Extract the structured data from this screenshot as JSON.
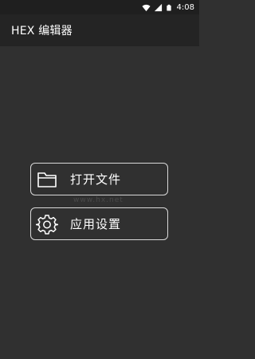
{
  "status_bar": {
    "time": "4:08",
    "icons": [
      "wifi-icon",
      "signal-icon",
      "battery-icon"
    ]
  },
  "app_bar": {
    "title": "HEX 编辑器"
  },
  "menu": {
    "open_file": {
      "label": "打开文件",
      "icon": "folder-icon"
    },
    "settings": {
      "label": "应用设置",
      "icon": "gear-icon"
    }
  },
  "watermark": "www.hx.net",
  "colors": {
    "background": "#303030",
    "app_bar": "#242424",
    "status_bar": "#1f1f1f",
    "button_border": "#d9d9d9",
    "text": "#ffffff"
  }
}
